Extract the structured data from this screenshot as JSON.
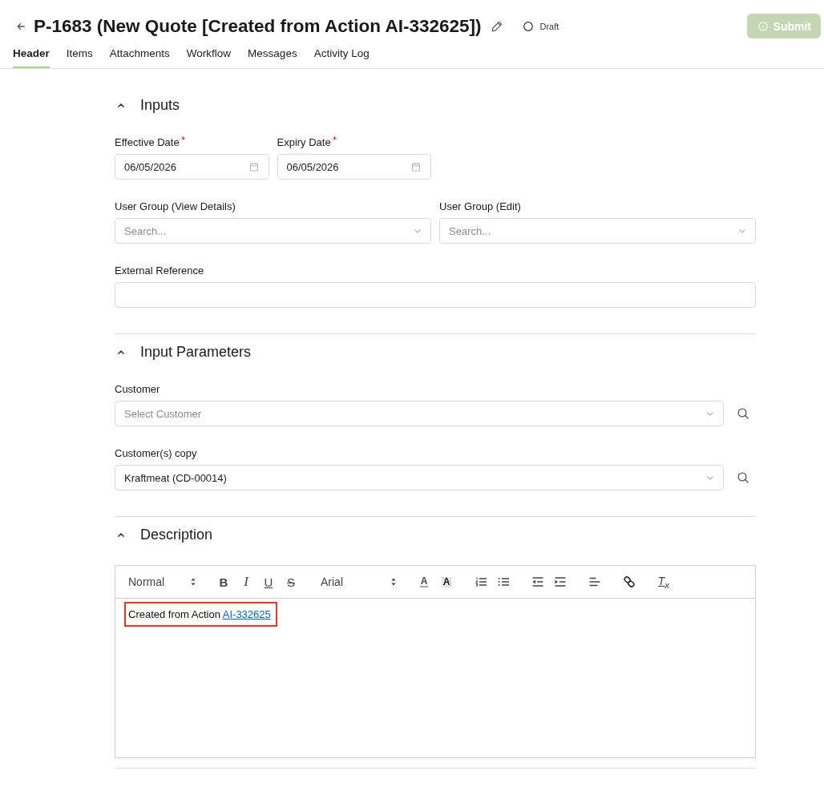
{
  "header": {
    "title": "P-1683 (New Quote [Created from Action AI-332625])",
    "status": "Draft",
    "submit": {
      "label": "Submit",
      "disabled": true
    }
  },
  "tabs": [
    {
      "label": "Header",
      "selected": true
    },
    {
      "label": "Items",
      "selected": false
    },
    {
      "label": "Attachments",
      "selected": false
    },
    {
      "label": "Workflow",
      "selected": false
    },
    {
      "label": "Messages",
      "selected": false
    },
    {
      "label": "Activity Log",
      "selected": false
    }
  ],
  "sections": [
    {
      "title": "Inputs",
      "expanded": true,
      "rows": [
        [
          {
            "label": "Effective Date",
            "required": true,
            "kind": "date",
            "value": "06/05/2026"
          },
          {
            "label": "Expiry Date",
            "required": true,
            "kind": "date",
            "value": "06/05/2026"
          }
        ],
        [
          {
            "label": "User Group (View Details)",
            "required": false,
            "kind": "select",
            "placeholder": "Search..."
          },
          {
            "label": "User Group (Edit)",
            "required": false,
            "kind": "select",
            "placeholder": "Search..."
          }
        ],
        [
          {
            "label": "External Reference",
            "required": false,
            "kind": "text"
          }
        ]
      ]
    },
    {
      "title": "Input Parameters",
      "expanded": true,
      "rows": [
        [
          {
            "label": "Customer",
            "required": false,
            "kind": "lookup",
            "placeholder": "Select Customer"
          }
        ],
        [
          {
            "label": "Customer(s) copy",
            "required": false,
            "kind": "lookup",
            "value": "Kraftmeat (CD-00014)"
          }
        ]
      ]
    },
    {
      "title": "Description",
      "expanded": true,
      "editor": {
        "toolbar": [
          {
            "kind": "header-picker",
            "value": "Normal"
          },
          {
            "kind": "group",
            "buttons": [
              {
                "kind": "bold",
                "label": "B"
              },
              {
                "kind": "italic",
                "label": "I"
              },
              {
                "kind": "underline",
                "label": "U"
              },
              {
                "kind": "strike",
                "label": "S"
              }
            ]
          },
          {
            "kind": "font-picker",
            "value": "Arial"
          },
          {
            "kind": "group",
            "buttons": [
              {
                "kind": "color",
                "label": "A"
              },
              {
                "kind": "background",
                "label": "A"
              }
            ]
          },
          {
            "kind": "group",
            "buttons": [
              {
                "kind": "ordered-list"
              },
              {
                "kind": "bullet-list"
              }
            ]
          },
          {
            "kind": "group",
            "buttons": [
              {
                "kind": "outdent"
              },
              {
                "kind": "indent"
              }
            ]
          },
          {
            "kind": "group",
            "buttons": [
              {
                "kind": "align"
              }
            ]
          },
          {
            "kind": "group",
            "buttons": [
              {
                "kind": "link"
              }
            ]
          },
          {
            "kind": "group",
            "buttons": [
              {
                "kind": "clean",
                "label": "T$_{x}$"
              }
            ]
          }
        ],
        "content": {
          "text": "Created from Action",
          "link": "AI-332625",
          "highlighted": true
        }
      }
    }
  ]
}
